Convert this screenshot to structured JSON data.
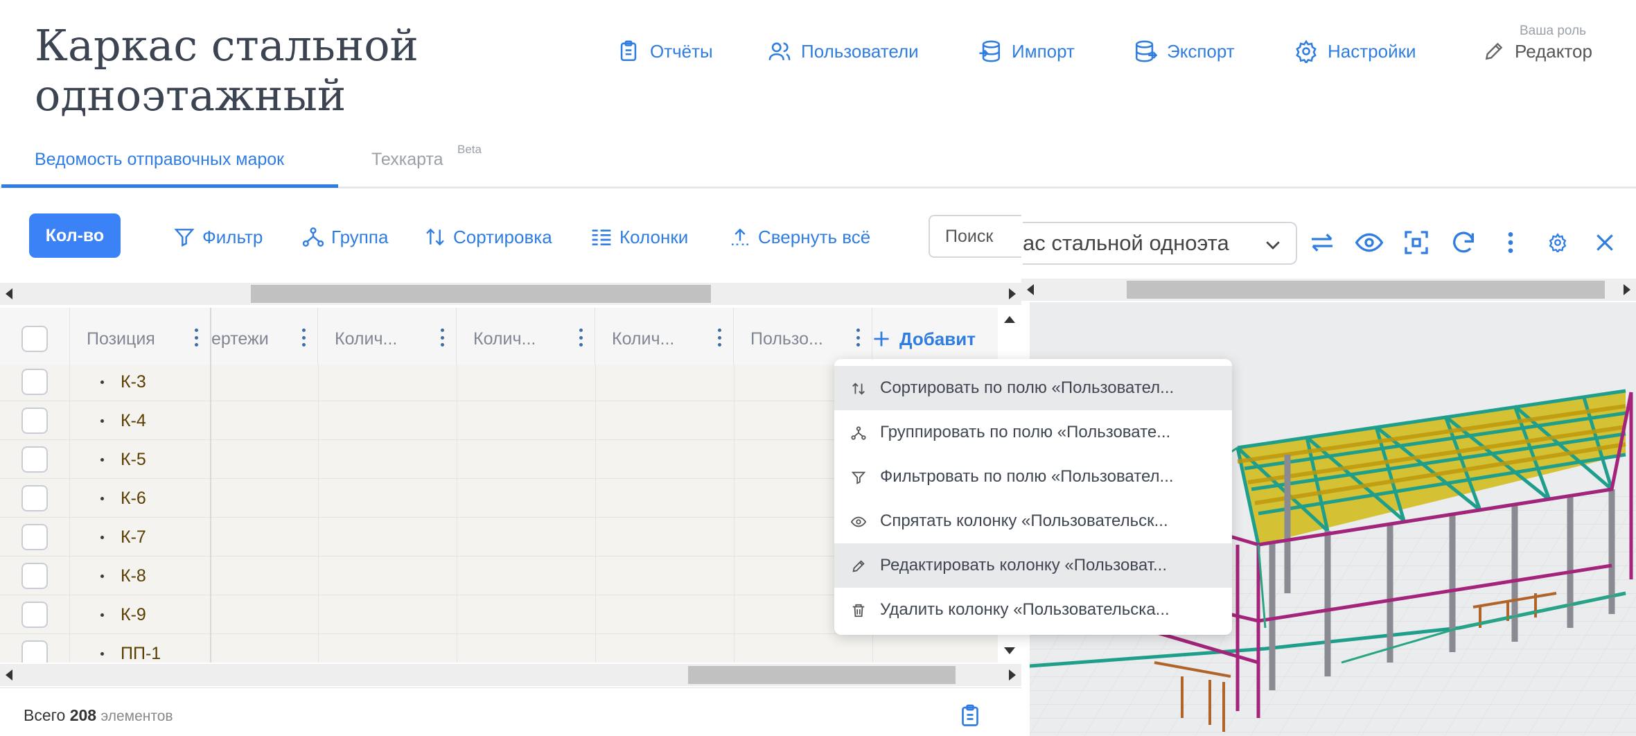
{
  "header": {
    "title_line1": "Каркас стальной",
    "title_line2": "одноэтажный",
    "nav": {
      "reports": "Отчёты",
      "users": "Пользователи",
      "import": "Импорт",
      "export": "Экспорт",
      "settings": "Настройки"
    },
    "role_caption": "Ваша роль",
    "role": "Редактор",
    "tabs": {
      "statement": "Ведомость отправочных марок",
      "techmap": "Техкарта",
      "techmap_badge": "Beta"
    }
  },
  "toolbar": {
    "qty": "Кол-во",
    "filter": "Фильтр",
    "group": "Группа",
    "sort": "Сортировка",
    "columns": "Колонки",
    "collapse": "Свернуть всё",
    "search_placeholder": "Поиск"
  },
  "table": {
    "columns": [
      "Позиция",
      "ертежи",
      "Колич...",
      "Колич...",
      "Колич...",
      "Пользо..."
    ],
    "add_column": "Добавит",
    "rows": [
      "К-3",
      "К-4",
      "К-5",
      "К-6",
      "К-7",
      "К-8",
      "К-9",
      "ПП-1"
    ]
  },
  "footer": {
    "prefix": "Всего",
    "count": "208",
    "suffix": "элементов"
  },
  "viewer": {
    "model_name": "ас стальной одноэта"
  },
  "context_menu": [
    "Сортировать по полю «Пользовател...",
    "Группировать по полю «Пользовате...",
    "Фильтровать по полю «Пользовател...",
    "Спрятать колонку «Пользовательск...",
    "Редактировать колонку «Пользоват...",
    "Удалить колонку «Пользовательска..."
  ],
  "colors": {
    "accent": "#2f7de1",
    "primary_button": "#3b82f6",
    "row_bg": "#f4f3ef"
  }
}
